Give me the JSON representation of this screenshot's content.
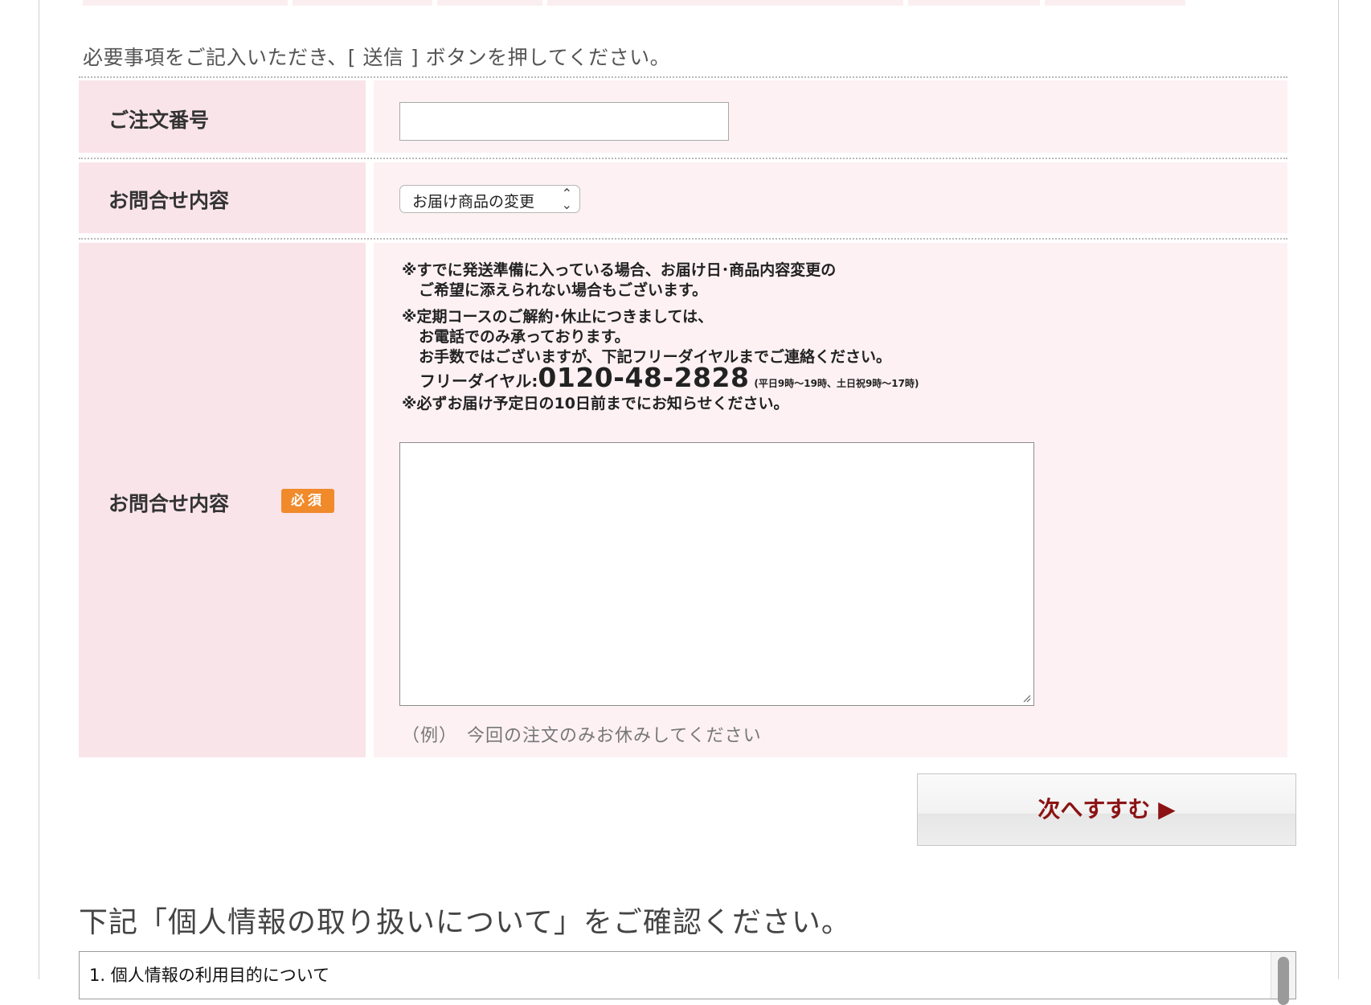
{
  "intro": "必要事項をご記入いただき、[ 送信 ] ボタンを押してください。",
  "order_number": {
    "label": "ご注文番号",
    "value": "",
    "placeholder": ""
  },
  "inquiry_type": {
    "label": "お問合せ内容",
    "selected": "お届け商品の変更"
  },
  "inquiry_detail": {
    "label": "お問合せ内容",
    "badge": "必須",
    "note1_a": "※すでに発送準備に入っている場合、お届け日･商品内容変更の",
    "note1_b": "ご希望に添えられない場合もございます。",
    "note2_a": "※定期コースのご解約･休止につきましては、",
    "note2_b": "お電話でのみ承っております。",
    "note2_c": "お手数ではございますが、下記フリーダイヤルまでご連絡ください。",
    "phone_label": "フリーダイヤル:",
    "phone_number": "0120-48-2828",
    "phone_hours": "(平日9時～19時、土日祝9時～17時)",
    "note3": "※必ずお届け予定日の10日前までにお知らせください。",
    "example": "（例）　今回の注文のみお休みしてください"
  },
  "next_button": "次へすすむ ▶",
  "privacy": {
    "heading": "下記「個人情報の取り扱いについて」をご確認ください。",
    "first_item": "1.  個人情報の利用目的について"
  },
  "colors": {
    "label_bg": "#f9e4ea",
    "cell_bg": "#fdf1f4",
    "badge": "#f08a2b",
    "button_text": "#8b1313"
  }
}
